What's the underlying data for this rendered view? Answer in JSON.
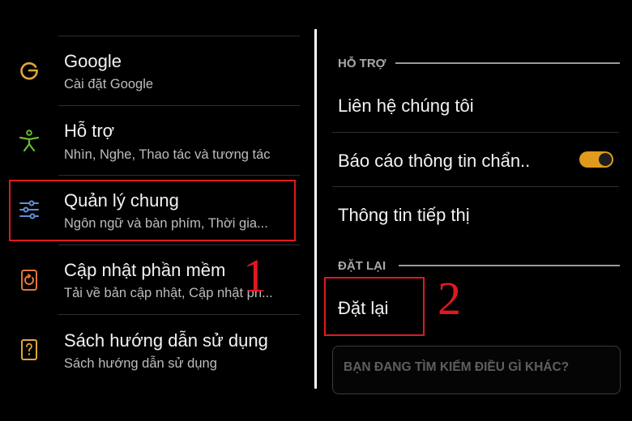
{
  "left_menu": {
    "items": [
      {
        "title": "Google",
        "subtitle": "Cài đặt Google",
        "icon": "google-icon",
        "icon_color": "#e0a63a"
      },
      {
        "title": "Hỗ trợ",
        "subtitle": "Nhìn, Nghe, Thao tác và tương tác",
        "icon": "accessibility-icon",
        "icon_color": "#66bb33"
      },
      {
        "title": "Quản lý chung",
        "subtitle": "Ngôn ngữ và bàn phím, Thời gia...",
        "icon": "sliders-icon",
        "icon_color": "#5f8fd6"
      },
      {
        "title": "Cập nhật phần mềm",
        "subtitle": "Tải về bản cập nhật, Cập nhật ph...",
        "icon": "software-update-icon",
        "icon_color": "#e0763a"
      },
      {
        "title": "Sách hướng dẫn sử dụng",
        "subtitle": "Sách hướng dẫn sử dụng",
        "icon": "manual-icon",
        "icon_color": "#e0a63a"
      }
    ]
  },
  "annotations": {
    "step1": "1",
    "step2": "2",
    "highlight_color": "#e0191f"
  },
  "right_panel": {
    "support_section": {
      "header": "HỖ TRỢ",
      "items": [
        "Liên hệ chúng tôi",
        "Báo cáo thông tin chẩn..",
        "Thông tin tiếp thị"
      ]
    },
    "diagnostic_toggle_on": true,
    "toggle_color": "#e09a1d",
    "reset_section": {
      "header": "ĐẶT LẠI",
      "items": [
        "Đặt lại"
      ]
    },
    "search": {
      "placeholder": "BẠN ĐANG TÌM KIẾM ĐIỀU GÌ KHÁC?"
    }
  }
}
